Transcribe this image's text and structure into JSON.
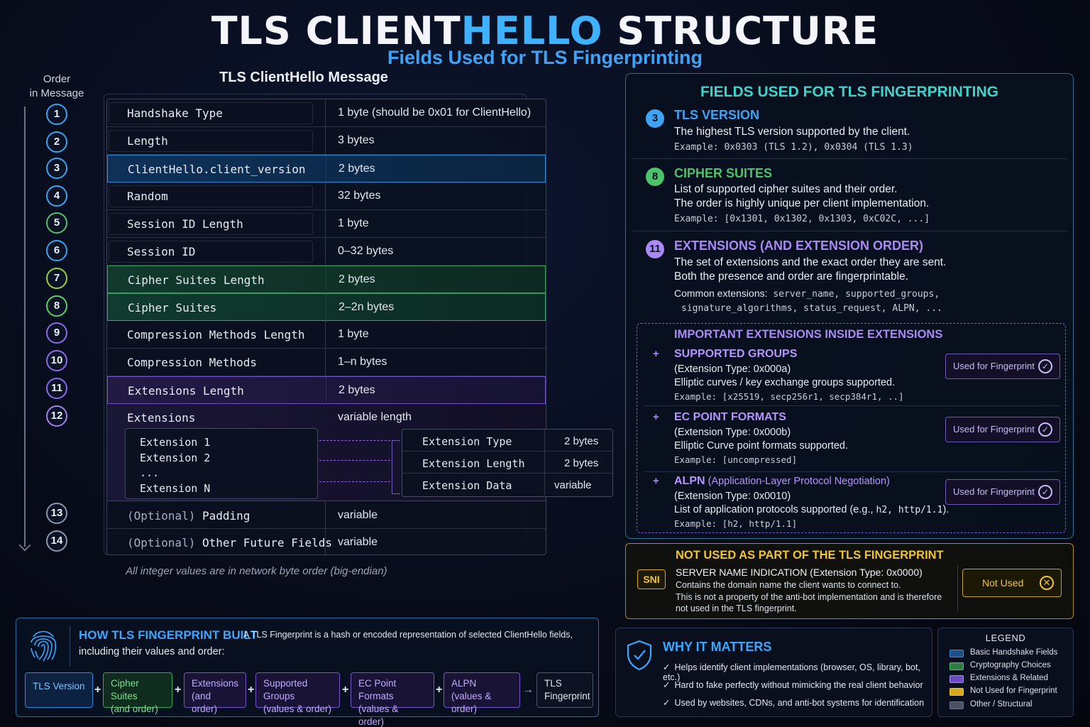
{
  "header": {
    "title_a": "TLS CLIENT",
    "title_b": "HELLO",
    "title_c": " STRUCTURE",
    "subtitle": "Fields Used for TLS Fingerprinting"
  },
  "order": {
    "label_line1": "Order",
    "label_line2": "in Message",
    "numbers": [
      "1",
      "2",
      "3",
      "4",
      "5",
      "6",
      "7",
      "8",
      "9",
      "10",
      "11",
      "12",
      "13",
      "14"
    ]
  },
  "message": {
    "title": "TLS ClientHello Message",
    "rows": [
      {
        "name": "Handshake Type",
        "size": "1 byte (should be 0x01 for ClientHello)"
      },
      {
        "name": "Length",
        "size": "3 bytes"
      },
      {
        "name": "ClientHello.client_version",
        "size": "2 bytes"
      },
      {
        "name": "Random",
        "size": "32 bytes"
      },
      {
        "name": "Session ID Length",
        "size": "1 byte"
      },
      {
        "name": "Session ID",
        "size": "0–32 bytes"
      },
      {
        "name": "Cipher Suites Length",
        "size": "2 bytes"
      },
      {
        "name": "Cipher Suites",
        "size": "2–2n bytes"
      },
      {
        "name": "Compression Methods Length",
        "size": "1 byte"
      },
      {
        "name": "Compression Methods",
        "size": "1–n bytes"
      },
      {
        "name": "Extensions Length",
        "size": "2 bytes"
      },
      {
        "name": "Extensions",
        "size": "variable length"
      }
    ],
    "extensions_list": [
      "Extension 1",
      "Extension 2",
      "...",
      "Extension N"
    ],
    "extension_detail": [
      {
        "key": "Extension Type",
        "value": "2 bytes"
      },
      {
        "key": "Extension Length",
        "value": "2 bytes"
      },
      {
        "key": "Extension Data",
        "value": "variable"
      }
    ],
    "optional_rows": [
      {
        "prefix": "(Optional)",
        "name": "Padding",
        "size": "variable"
      },
      {
        "prefix": "(Optional)",
        "name": "Other Future Fields",
        "size": "variable"
      }
    ],
    "note": "All integer values are in network byte order (big-endian)"
  },
  "fingerprint_fields": {
    "title": "FIELDS USED FOR TLS FINGERPRINTING",
    "items": [
      {
        "badge": "3",
        "heading": "TLS VERSION",
        "lines": [
          "The highest TLS version supported by the client."
        ],
        "example": "Example: 0x0303 (TLS 1.2), 0x0304 (TLS 1.3)"
      },
      {
        "badge": "8",
        "heading": "CIPHER SUITES",
        "lines": [
          "List of supported cipher suites and their order.",
          "The order is highly unique per client implementation."
        ],
        "example": "Example: [0x1301, 0x1302, 0x1303, 0xC02C, ...]"
      },
      {
        "badge": "11",
        "heading": "EXTENSIONS (AND EXTENSION ORDER)",
        "lines": [
          "The set of extensions and the exact order they are sent.",
          "Both the presence and order are fingerprintable."
        ],
        "example_label": "Common extensions:",
        "example": "server_name, supported_groups,",
        "example2": "signature_algorithms, status_request, ALPN, ..."
      }
    ],
    "important": {
      "title": "IMPORTANT EXTENSIONS INSIDE EXTENSIONS",
      "plus": "+",
      "used_label": "Used for Fingerprint",
      "check": "✓",
      "items": [
        {
          "heading": "SUPPORTED GROUPS",
          "sub": "",
          "type": "(Extension Type: 0x000a)",
          "desc_a": "Elliptic curves / key exchange groups supported.",
          "desc_b": "",
          "desc_c": "",
          "example": "Example: [x25519, secp256r1, secp384r1, ..]"
        },
        {
          "heading": "EC POINT FORMATS",
          "sub": "",
          "type": "(Extension Type: 0x000b)",
          "desc_a": "Elliptic Curve point formats supported.",
          "desc_b": "",
          "desc_c": "",
          "example": "Example: [uncompressed]"
        },
        {
          "heading": "ALPN",
          "sub": " (Application-Layer Protocol Negotiation)",
          "type": "(Extension Type: 0x0010)",
          "desc_a": "List of application protocols supported (e.g., ",
          "desc_b": "h2, http/1.1",
          "desc_c": ").",
          "example": "Example: [h2, http/1.1]"
        }
      ]
    }
  },
  "not_used": {
    "title": "NOT USED AS PART OF THE TLS FINGERPRINT",
    "badge": "SNI",
    "heading": "SERVER NAME INDICATION (Extension Type: 0x0000)",
    "lines": [
      "Contains the domain name the client wants to connect to.",
      "This is not a property of the anti-bot implementation and is therefore",
      "not used in the TLS fingerprint."
    ],
    "button": "Not Used",
    "x": "✕"
  },
  "how_built": {
    "title": "HOW TLS FINGERPRINT BUILT",
    "desc_a": "A TLS Fingerprint is a hash or encoded representation of selected ClientHello fields,",
    "desc_b": "including their values and order:",
    "plus": "+",
    "arrow": "→",
    "chips": [
      {
        "line1": "TLS Version",
        "line2": ""
      },
      {
        "line1": "Cipher Suites",
        "line2": "(and order)"
      },
      {
        "line1": "Extensions",
        "line2": "(and order)"
      },
      {
        "line1": "Supported Groups",
        "line2": "(values & order)"
      },
      {
        "line1": "EC Point Formats",
        "line2": "(values & order)"
      },
      {
        "line1": "ALPN",
        "line2": "(values & order)"
      },
      {
        "line1": "TLS",
        "line2": "Fingerprint"
      }
    ]
  },
  "why": {
    "title": "WHY IT MATTERS",
    "tick": "✓",
    "items": [
      "Helps identify client implementations (browser, OS, library, bot, etc.)",
      "Hard to fake perfectly without mimicking the real client behavior",
      "Used by websites, CDNs, and anti-bot systems for identification"
    ]
  },
  "legend": {
    "title": "LEGEND",
    "items": [
      {
        "label": "Basic Handshake Fields",
        "color": "#1f4f86"
      },
      {
        "label": "Cryptography Choices",
        "color": "#2f7a45"
      },
      {
        "label": "Extensions & Related",
        "color": "#6a4cc0"
      },
      {
        "label": "Not Used for Fingerprint",
        "color": "#d3a91f"
      },
      {
        "label": "Other / Structural",
        "color": "#4a5264"
      }
    ]
  },
  "colors": {
    "blue": "#3fa3f5",
    "green": "#4cc26a",
    "teal": "#3fd2c8",
    "purple": "#a98af5",
    "yellow": "#f0c533"
  }
}
